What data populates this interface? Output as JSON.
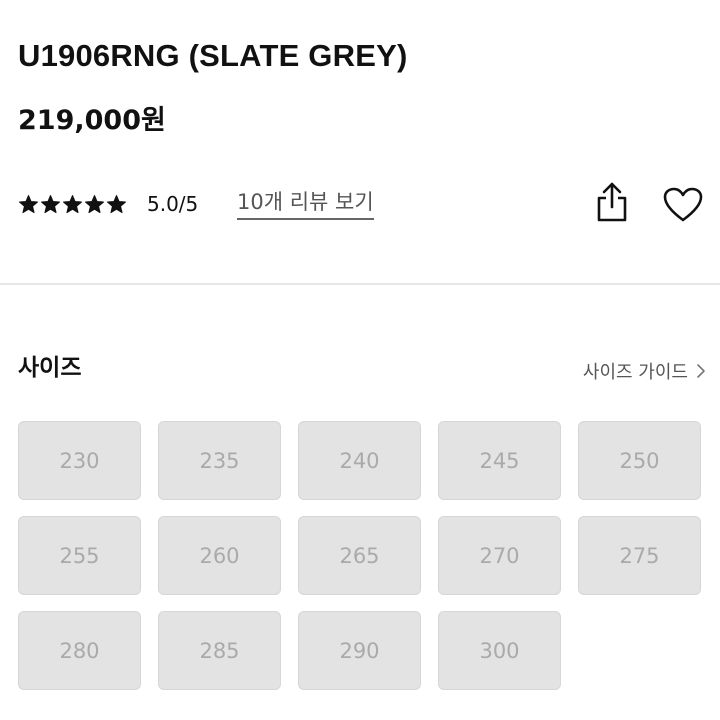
{
  "product": {
    "title": "U1906RNG (SLATE GREY)",
    "price": "219,000원"
  },
  "rating": {
    "stars": 5,
    "max_stars": 5,
    "score_text": "5.0/5",
    "review_link": "10개 리뷰 보기"
  },
  "actions": {
    "share_icon": "share-icon",
    "wishlist_icon": "heart-icon"
  },
  "size_section": {
    "title": "사이즈",
    "guide_label": "사이즈 가이드",
    "options": [
      "230",
      "235",
      "240",
      "245",
      "250",
      "255",
      "260",
      "265",
      "270",
      "275",
      "280",
      "285",
      "290",
      "300"
    ],
    "all_sold_out": true
  },
  "colors": {
    "text": "#111111",
    "muted": "#555555",
    "disabled_bg": "#e3e3e3",
    "disabled_text": "#aaaaaa"
  }
}
